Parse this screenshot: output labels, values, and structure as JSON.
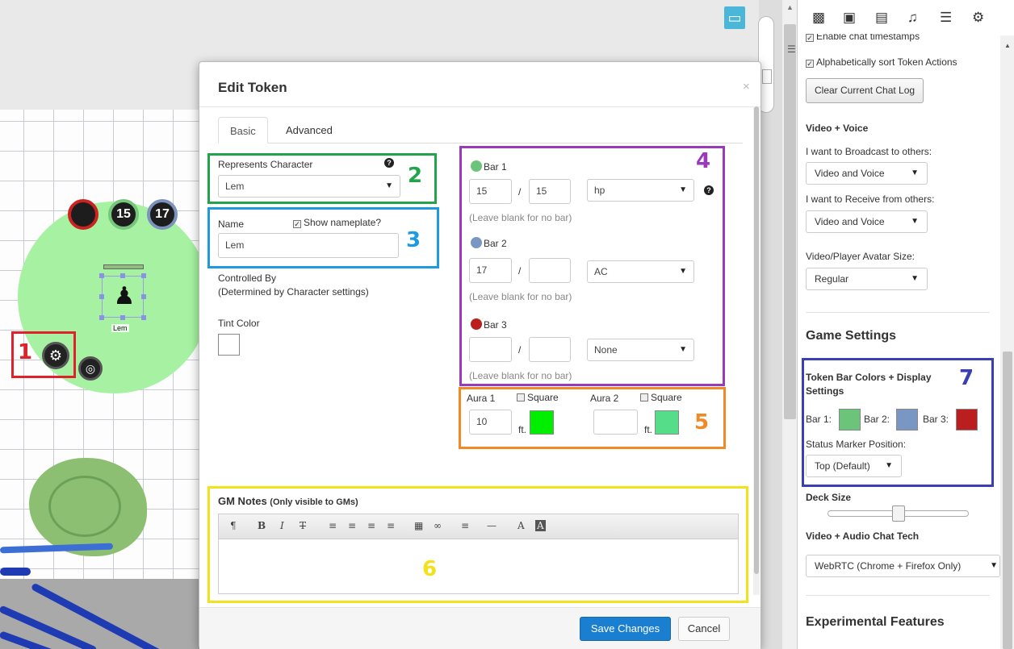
{
  "annotations": {
    "n1": "1",
    "n2": "2",
    "n3": "3",
    "n4": "4",
    "n5": "5",
    "n6": "6",
    "n7": "7",
    "colors": {
      "n1": "#e0202a",
      "n2": "#21a44a",
      "n3": "#1e9bdf",
      "n4": "#9a3ab8",
      "n5": "#f08a24",
      "n6": "#f2e21c",
      "n7": "#3a3fb4"
    }
  },
  "canvas": {
    "token": {
      "name": "Lem",
      "bubbles": [
        "",
        "15",
        "17"
      ],
      "bubble_colors": {
        "red": "#cc2222",
        "green": "#76c67c",
        "blue": "#7b93bb"
      },
      "aura_color": "#a6f2a2"
    }
  },
  "dialog": {
    "title": "Edit Token",
    "close": "×",
    "tabs": [
      "Basic",
      "Advanced"
    ],
    "represents": {
      "label": "Represents Character",
      "value": "Lem"
    },
    "name": {
      "label": "Name",
      "show_nameplate": "Show nameplate?",
      "value": "Lem"
    },
    "controlled_by": {
      "label": "Controlled By",
      "note": "(Determined by Character settings)"
    },
    "tint": {
      "label": "Tint Color",
      "color": "#ffffff"
    },
    "bars": [
      {
        "label": "Bar 1",
        "color": "#6cc47a",
        "value": "15",
        "max": "15",
        "link": "hp",
        "hint": "(Leave blank for no bar)"
      },
      {
        "label": "Bar 2",
        "color": "#7a97c4",
        "value": "17",
        "max": "",
        "link": "AC",
        "hint": "(Leave blank for no bar)"
      },
      {
        "label": "Bar 3",
        "color": "#bb1e1e",
        "value": "",
        "max": "",
        "link": "None",
        "hint": "(Leave blank for no bar)"
      }
    ],
    "separator": "/",
    "aura1": {
      "label": "Aura 1",
      "square": "Square",
      "radius": "10",
      "unit": "ft.",
      "color": "#00ee00"
    },
    "aura2": {
      "label": "Aura 2",
      "square": "Square",
      "radius": "",
      "unit": "ft.",
      "color": "#55dd8a"
    },
    "gm_notes": {
      "label": "GM Notes",
      "sub": "(Only visible to GMs)"
    },
    "toolbar": [
      "¶",
      "B",
      "I",
      "T",
      "≡",
      "≡",
      "≡",
      "≡",
      "▦",
      "∞",
      "≡",
      "—",
      "A",
      "A"
    ],
    "save": "Save Changes",
    "cancel": "Cancel"
  },
  "sidebar": {
    "tabs": [
      "chat",
      "art",
      "journal",
      "jukebox",
      "compendium",
      "settings"
    ],
    "timestamps": "Enable chat timestamps",
    "sort_actions": "Alphabetically sort Token Actions",
    "clear_chat": "Clear Current Chat Log",
    "video_voice": "Video + Voice",
    "broadcast_label": "I want to Broadcast to others:",
    "broadcast_value": "Video and Voice",
    "receive_label": "I want to Receive from others:",
    "receive_value": "Video and Voice",
    "avatar_label": "Video/Player Avatar Size:",
    "avatar_value": "Regular",
    "game_settings": "Game Settings",
    "bar_colors_title": "Token Bar Colors + Display Settings",
    "bar1": "Bar 1:",
    "bar2": "Bar 2:",
    "bar3": "Bar 3:",
    "bar_colors": [
      "#6cc47a",
      "#7a97c4",
      "#bb1e1e"
    ],
    "status_label": "Status Marker Position:",
    "status_value": "Top (Default)",
    "deck_size": "Deck Size",
    "deck_level": 0.47,
    "av_tech": "Video + Audio Chat Tech",
    "av_tech_value": "WebRTC (Chrome + Firefox Only)",
    "experimental": "Experimental Features"
  }
}
